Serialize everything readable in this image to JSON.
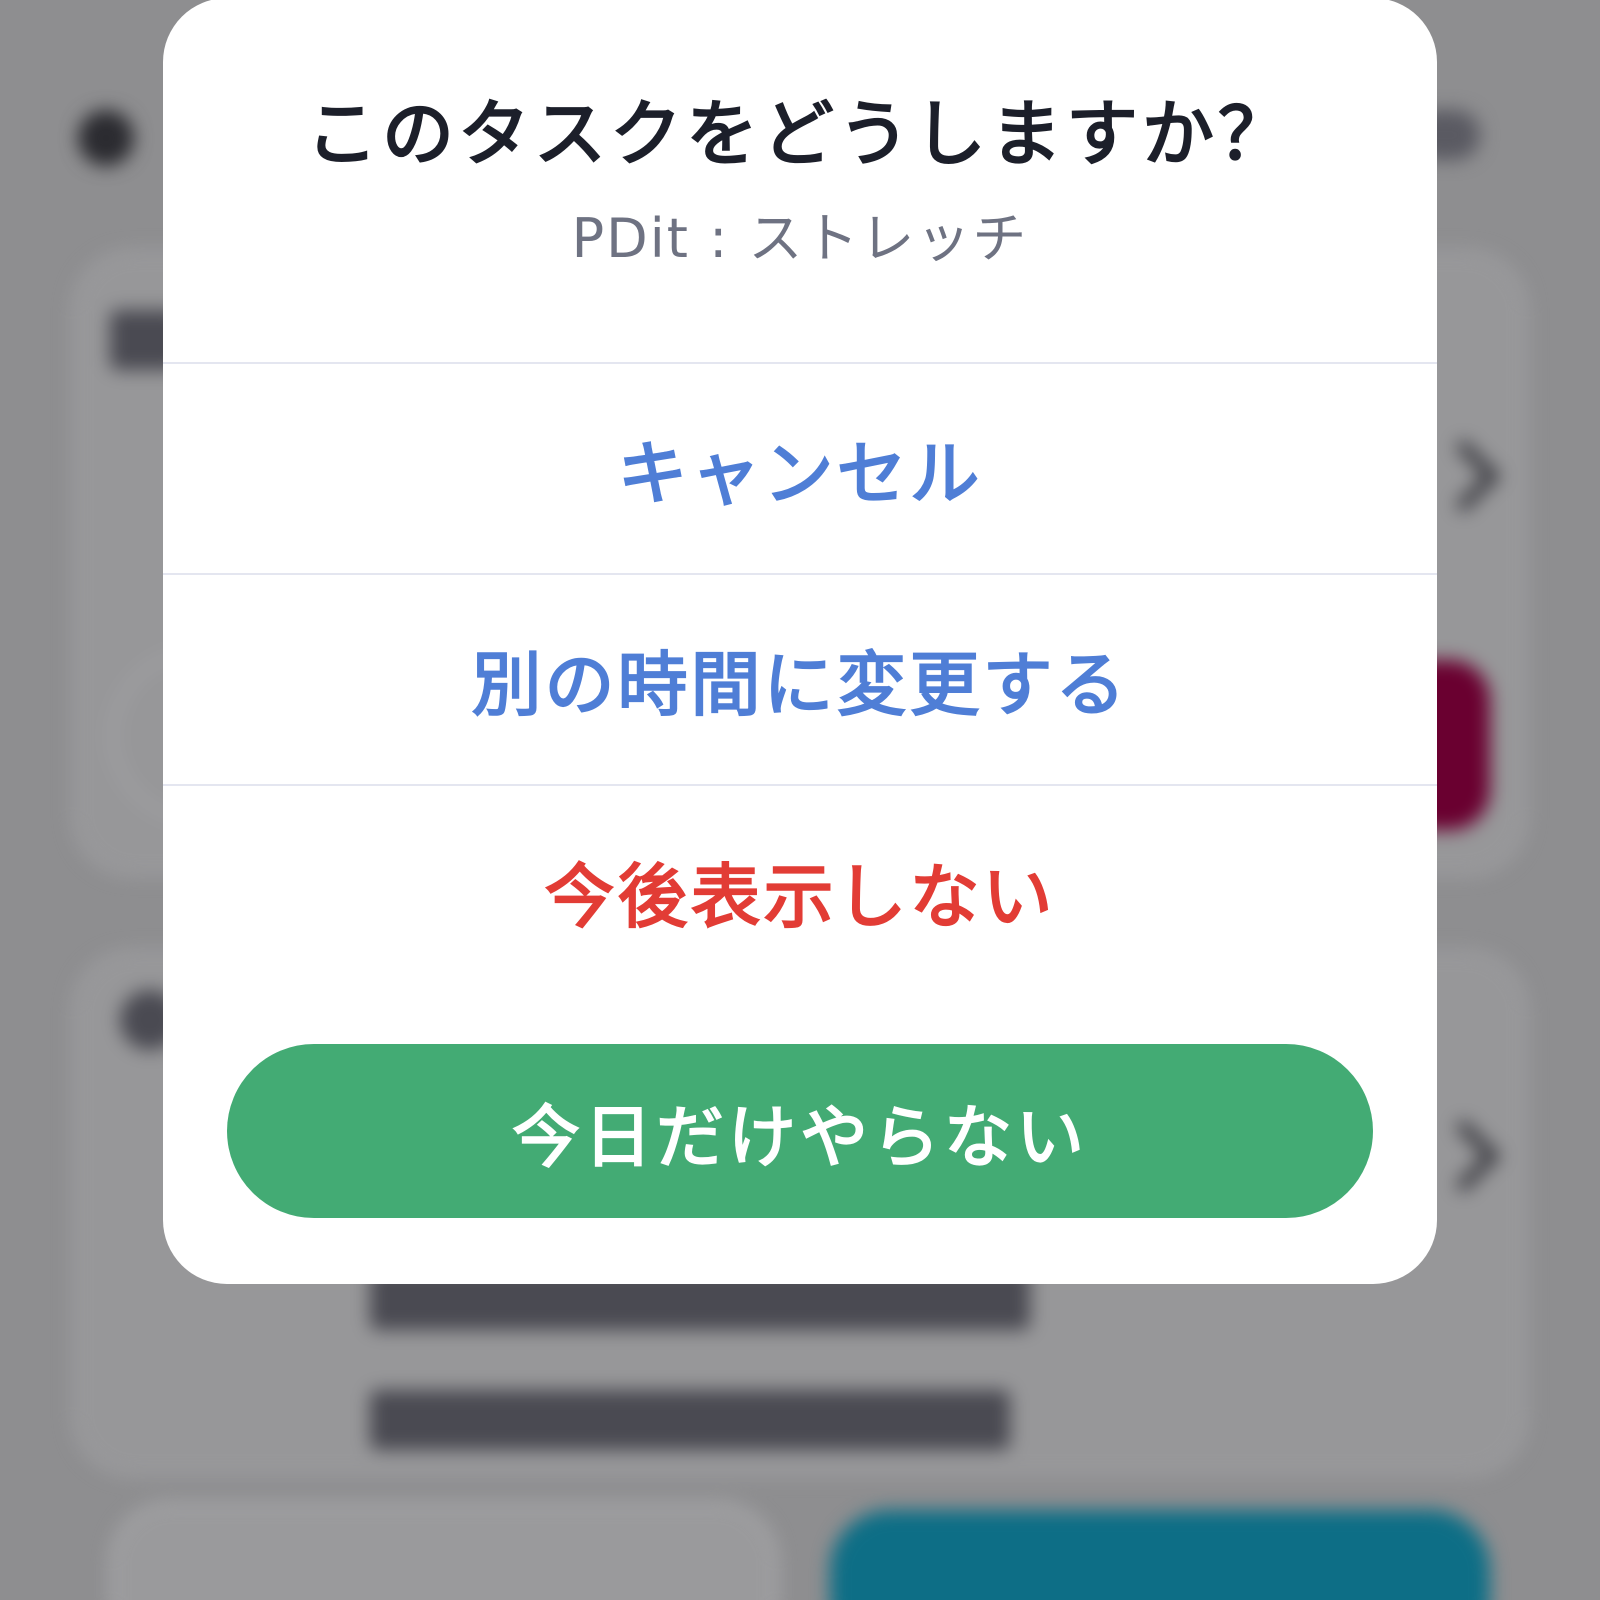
{
  "dialog": {
    "title": "このタスクをどうしますか？",
    "subtitle": "PDit : ストレッチ",
    "actions": [
      {
        "label": "キャンセル",
        "color": "#4f7ed6"
      },
      {
        "label": "別の時間に変更する",
        "color": "#4f7ed6"
      },
      {
        "label": "今後表示しない",
        "color": "#e23c35"
      }
    ],
    "primary_button": {
      "label": "今日だけやらない",
      "color": "#43ab74"
    }
  },
  "colors": {
    "overlay": "#8e8e90",
    "title_text": "#1c1f2a",
    "subtitle_text": "#6e7282",
    "divider": "#e4e6f0"
  }
}
